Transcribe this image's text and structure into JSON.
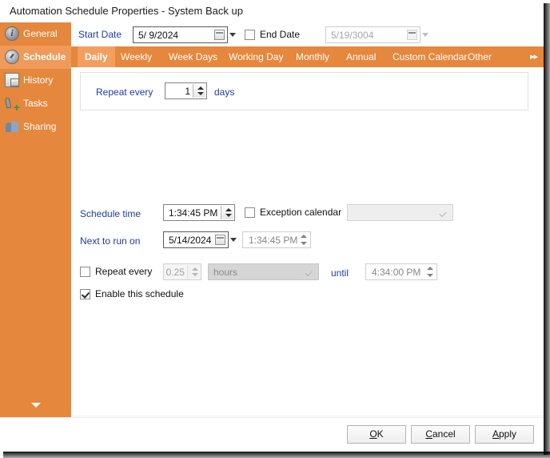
{
  "window": {
    "title": "Automation Schedule Properties - System Back up",
    "accent_color": "#e5873c",
    "accent_selected_color": "#ef9a58",
    "label_color": "#1f3d9e"
  },
  "sidebar": {
    "items": [
      {
        "label": "General",
        "icon": "info-icon",
        "selected": false
      },
      {
        "label": "Schedule",
        "icon": "clock-icon",
        "selected": true
      },
      {
        "label": "History",
        "icon": "history-icon",
        "selected": false
      },
      {
        "label": "Tasks",
        "icon": "tasks-icon",
        "selected": false
      },
      {
        "label": "Sharing",
        "icon": "sharing-icon",
        "selected": false
      }
    ],
    "more_icon": "chevron-down-icon"
  },
  "date_row": {
    "start_date_label": "Start Date",
    "start_date_value": "5/ 9/2024",
    "end_date_label": "End Date",
    "end_date_checked": false,
    "end_date_value": "5/19/3004",
    "calendar_icon": "calendar-icon",
    "dropdown_icon": "chevron-down-icon"
  },
  "tabs": {
    "items": [
      {
        "label": "Daily",
        "active": true
      },
      {
        "label": "Weekly",
        "active": false
      },
      {
        "label": "Week Days",
        "active": false
      },
      {
        "label": "Working Day",
        "active": false
      },
      {
        "label": "Monthly",
        "active": false
      },
      {
        "label": "Annual",
        "active": false
      },
      {
        "label": "Custom Calendar",
        "active": false
      },
      {
        "label": "Other",
        "active": false
      }
    ],
    "overflow_icon": "double-right-arrow-icon",
    "overflow_glyph": "▸▸"
  },
  "daily_panel": {
    "repeat_every_label": "Repeat every",
    "repeat_every_value": "1",
    "repeat_every_unit": "days"
  },
  "schedule": {
    "schedule_time_label": "Schedule time",
    "schedule_time_value": "1:34:45 PM",
    "exception_calendar_label": "Exception calendar",
    "exception_calendar_checked": false,
    "exception_calendar_value": "",
    "next_to_run_on_label": "Next to run on",
    "next_to_run_on_date": "5/14/2024",
    "next_to_run_on_time": "1:34:45 PM",
    "repeat_every_label": "Repeat every",
    "repeat_every_checked": false,
    "repeat_every_value": "0.25",
    "repeat_every_unit": "hours",
    "until_label": "until",
    "until_value": "4:34:00 PM",
    "enable_schedule_label": "Enable this schedule",
    "enable_schedule_checked": true
  },
  "footer": {
    "ok_label": "OK",
    "ok_accel": "O",
    "cancel_label": "Cancel",
    "cancel_accel": "C",
    "apply_label": "Apply",
    "apply_accel": "A"
  }
}
